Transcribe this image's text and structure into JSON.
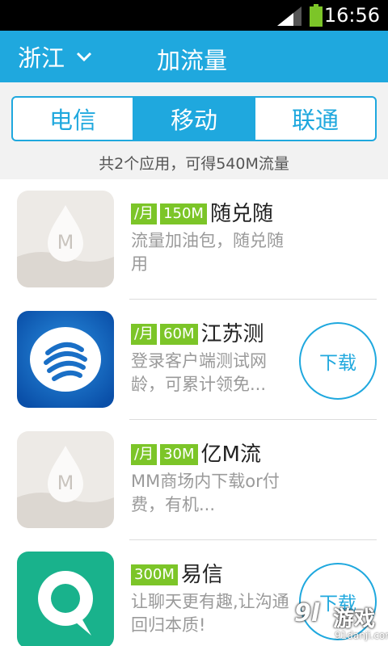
{
  "status_bar": {
    "time": "16:56"
  },
  "app_bar": {
    "region": "浙江",
    "title": "加流量"
  },
  "tabs": [
    {
      "label": "电信",
      "active": false
    },
    {
      "label": "移动",
      "active": true
    },
    {
      "label": "联通",
      "active": false
    }
  ],
  "summary": "共2个应用，可得540M流量",
  "apps": [
    {
      "badge_period": "/月",
      "badge_data": "150M",
      "name": "随兑随",
      "desc": "流量加油包，随兑随用",
      "icon": "drop-m-icon"
    },
    {
      "badge_period": "/月",
      "badge_data": "60M",
      "name": "江苏测",
      "desc": "登录客户端测试网龄，可累计领免...",
      "icon": "china-mobile-icon",
      "button": "下载"
    },
    {
      "badge_period": "/月",
      "badge_data": "30M",
      "name": "亿M流",
      "desc": "MM商场内下载or付费，有机...",
      "icon": "drop-m-icon"
    },
    {
      "badge_data": "300M",
      "name": "易信",
      "desc": "让聊天更有趣,让沟通回归本质!",
      "icon": "yixin-icon",
      "button": "下载"
    }
  ],
  "watermark": {
    "logo": "9l",
    "text": "游戏",
    "url": "91danji.com"
  },
  "colors": {
    "accent": "#1fa8de",
    "badge": "#7cc528",
    "muted_text": "#9a9a9a"
  }
}
